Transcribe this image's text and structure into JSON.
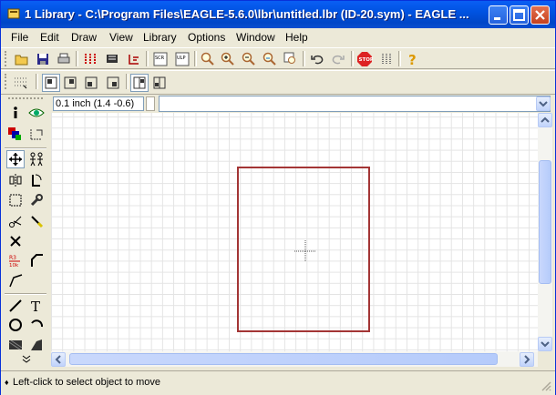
{
  "window": {
    "title": "1 Library - C:\\Program Files\\EAGLE-5.6.0\\lbr\\untitled.lbr (ID-20.sym) - EAGLE ..."
  },
  "menu": [
    "File",
    "Edit",
    "Draw",
    "View",
    "Library",
    "Options",
    "Window",
    "Help"
  ],
  "toolbar": {
    "icons": [
      "open-icon",
      "save-icon",
      "print-icon",
      "cam-icon",
      "board-icon",
      "schematic-icon",
      "script-icon",
      "ulp-icon",
      "zoom-fit-icon",
      "zoom-in-icon",
      "zoom-out-icon",
      "zoom-redraw-icon",
      "zoom-select-icon",
      "undo-icon",
      "redo-icon",
      "stop-icon",
      "go-icon",
      "help-icon"
    ]
  },
  "coord": {
    "value": "0.1 inch (1.4 -0.6)"
  },
  "command": {
    "value": ""
  },
  "status": {
    "text": "Left-click to select object to move"
  },
  "colors": {
    "symbol_frame": "#a33535",
    "title_blue": "#0053e1"
  }
}
